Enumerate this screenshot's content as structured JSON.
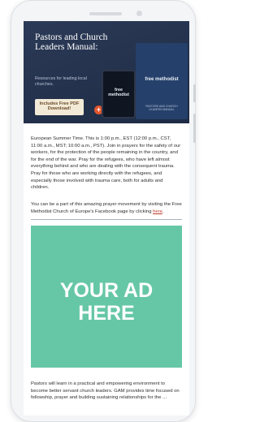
{
  "banner": {
    "title": "Pastors and Church Leaders Manual:",
    "subtitle": "Resources for leading local churches.",
    "pdf_badge": "Includes Free PDF Download!",
    "plus": "+",
    "tablet_brand": "free methodist",
    "book_brand": "free methodist",
    "book_tagline": "PASTORS AND CHURCH LEADERS MANUAL"
  },
  "article": {
    "paragraph_1": "European Summer Time. This is 1:00 p.m., EST (12:00 p.m., CST, 11:00 a.m., MST; 10:00 a.m., PST). Join in prayers for the safety of our workers, for the protection of the people remaining in the country, and for the end of the war. Pray for the refugees, who have left almost everything behind and who are dealing with the consequent trauma. Pray for those who are working directly with the refugees, and especially those involved with trauma care, both for adults and children.",
    "paragraph_2_text": "You can be a part of this amazing prayer movement by visiting the Free Methodist Church of Europe's Facebook page by clicking ",
    "paragraph_2_link": "here",
    "paragraph_2_end": ".",
    "paragraph_3": "Pastors will learn in a practical and empowering environment to become better servant church leaders. GAM provides time focused on fellowship, prayer and building sustaining relationships for the ..."
  },
  "ad": {
    "line1": "YOUR AD",
    "line2": "HERE",
    "background_color": "#66c7a6"
  },
  "colors": {
    "banner_bg": "#2b3a57",
    "link": "#c0392b",
    "accent_plus": "#e2562f"
  }
}
